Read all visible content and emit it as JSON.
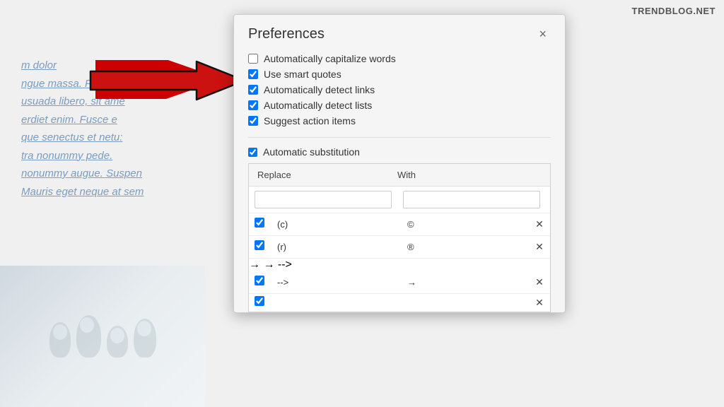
{
  "watermark": {
    "text": "TRENDBLOG.NET"
  },
  "background": {
    "text_lines": [
      "m dolor",
      "ngue massa. Fusce f",
      "usuada libero, sit ame",
      "erdiet enim. Fusce e",
      "que senectus et netu:",
      "tra nonummy pede.",
      "nonummy augue. Suspen",
      "Mauris eget neque at sem"
    ]
  },
  "dialog": {
    "title": "Preferences",
    "close_label": "×",
    "checkboxes": [
      {
        "id": "auto-cap",
        "label": "Automatically capitalize words",
        "checked": false
      },
      {
        "id": "smart-quotes",
        "label": "Use smart quotes",
        "checked": true
      },
      {
        "id": "detect-links",
        "label": "Automatically detect links",
        "checked": true
      },
      {
        "id": "detect-lists",
        "label": "Automatically detect lists",
        "checked": true
      },
      {
        "id": "action-items",
        "label": "Suggest action items",
        "checked": true
      }
    ],
    "auto_sub": {
      "label": "Automatic substitution",
      "checked": true
    },
    "table": {
      "headers": [
        "Replace",
        "With",
        ""
      ],
      "rows": [
        {
          "checked": true,
          "replace": "(c)",
          "with": "©"
        },
        {
          "checked": true,
          "replace": "(r)",
          "with": "®"
        },
        {
          "checked": true,
          "replace": "-->",
          "with": "→"
        },
        {
          "checked": true,
          "replace": "",
          "with": ""
        }
      ]
    }
  }
}
